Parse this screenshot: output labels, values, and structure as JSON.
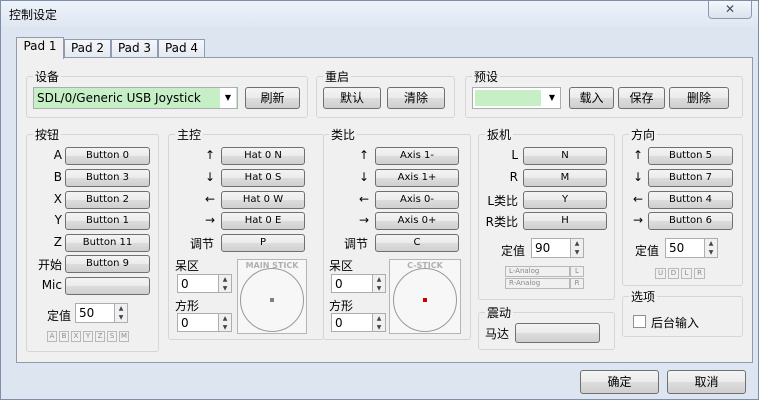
{
  "window": {
    "title": "控制设定",
    "close_glyph": "✕"
  },
  "tabs": [
    "Pad 1",
    "Pad 2",
    "Pad 3",
    "Pad 4"
  ],
  "device": {
    "label": "设备",
    "value": "SDL/0/Generic  USB  Joystick",
    "refresh_label": "刷新",
    "value_bg_color": "#c6efc6"
  },
  "restart": {
    "label": "重启",
    "default_label": "默认",
    "clear_label": "清除"
  },
  "preset": {
    "label": "预设",
    "value": "",
    "load_label": "载入",
    "save_label": "保存",
    "delete_label": "删除",
    "value_bg_color": "#c6efc6"
  },
  "buttons_group": {
    "label": "按钮",
    "rows": [
      {
        "key": "A",
        "value": "Button 0"
      },
      {
        "key": "B",
        "value": "Button 3"
      },
      {
        "key": "X",
        "value": "Button 2"
      },
      {
        "key": "Y",
        "value": "Button 1"
      },
      {
        "key": "Z",
        "value": "Button 11"
      },
      {
        "key": "开始",
        "value": "Button 9"
      },
      {
        "key": "Mic",
        "value": ""
      }
    ],
    "threshold_label": "定值",
    "threshold_value": "50",
    "indicators": [
      "A",
      "B",
      "X",
      "Y",
      "Z",
      "S",
      "M"
    ]
  },
  "main_stick": {
    "label": "主控",
    "rows": [
      {
        "icon": "↑",
        "value": "Hat 0 N"
      },
      {
        "icon": "↓",
        "value": "Hat 0 S"
      },
      {
        "icon": "←",
        "value": "Hat 0 W"
      },
      {
        "icon": "→",
        "value": "Hat 0 E"
      }
    ],
    "modifier_label": "调节",
    "modifier_value": "P",
    "deadzone_label": "呆区",
    "deadzone_value": "0",
    "square_label": "方形",
    "square_value": "0",
    "preview_caption": "MAIN STICK",
    "dot_color": "#808080"
  },
  "c_stick": {
    "label": "类比",
    "rows": [
      {
        "icon": "↑",
        "value": "Axis 1-"
      },
      {
        "icon": "↓",
        "value": "Axis 1+"
      },
      {
        "icon": "←",
        "value": "Axis 0-"
      },
      {
        "icon": "→",
        "value": "Axis 0+"
      }
    ],
    "modifier_label": "调节",
    "modifier_value": "C",
    "deadzone_label": "呆区",
    "deadzone_value": "0",
    "square_label": "方形",
    "square_value": "0",
    "preview_caption": "C-STICK",
    "dot_color": "#cc0000"
  },
  "triggers": {
    "label": "扳机",
    "rows": [
      {
        "key": "L",
        "value": "N"
      },
      {
        "key": "R",
        "value": "M"
      },
      {
        "key": "L类比",
        "value": "Y"
      },
      {
        "key": "R类比",
        "value": "H"
      }
    ],
    "threshold_label": "定值",
    "threshold_value": "90",
    "analog_rows": [
      {
        "name": "L-Analog",
        "key": "L"
      },
      {
        "name": "R-Analog",
        "key": "R"
      }
    ]
  },
  "rumble": {
    "label": "震动",
    "motor_label": "马达",
    "motor_value": ""
  },
  "dpad": {
    "label": "方向",
    "rows": [
      {
        "icon": "↑",
        "value": "Button 5"
      },
      {
        "icon": "↓",
        "value": "Button 7"
      },
      {
        "icon": "←",
        "value": "Button 4"
      },
      {
        "icon": "→",
        "value": "Button 6"
      }
    ],
    "threshold_label": "定值",
    "threshold_value": "50",
    "indicators": [
      "U",
      "D",
      "L",
      "R"
    ]
  },
  "options": {
    "label": "选项",
    "background_input_label": "后台输入",
    "background_input_checked": false
  },
  "footer": {
    "ok_label": "确定",
    "cancel_label": "取消"
  }
}
